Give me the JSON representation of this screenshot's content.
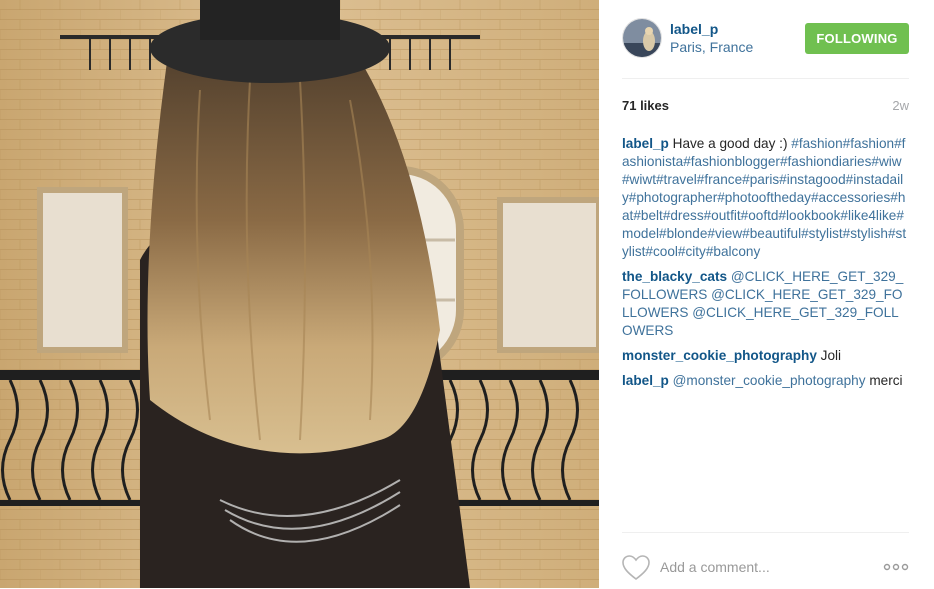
{
  "post": {
    "username": "label_p",
    "location": "Paris, France",
    "follow_label": "FOLLOWING",
    "likes": "71 likes",
    "time_ago": "2w"
  },
  "caption": {
    "user": "label_p",
    "text": "Have a good day :)",
    "hashtags": "#fashion#fashion#fashionista#fashionblogger#fashiondiaries#wiw#wiwt#travel#france#paris#instagood#instadaily#photographer#photooftheday#accessories#hat#belt#dress#outfit#ooftd#lookbook#like4like#model#blonde#view#beautiful#stylist#stylish#stylist#cool#city#balcony"
  },
  "comments": [
    {
      "user": "the_blacky_cats",
      "mention": "@CLICK_HERE_GET_329_FOLLOWERS @CLICK_HERE_GET_329_FOLLOWERS @CLICK_HERE_GET_329_FOLLOWERS",
      "text": ""
    },
    {
      "user": "monster_cookie_photography",
      "mention": "",
      "text": "Joli"
    },
    {
      "user": "label_p",
      "mention": "@monster_cookie_photography",
      "text": "merci"
    }
  ],
  "footer": {
    "comment_placeholder": "Add a comment...",
    "like_icon": "heart-icon",
    "more_icon": "more-options-icon"
  },
  "colors": {
    "follow_green": "#70c050",
    "username_blue": "#125688",
    "link_blue": "#3f729b",
    "muted_gray": "#a5a7aa"
  }
}
